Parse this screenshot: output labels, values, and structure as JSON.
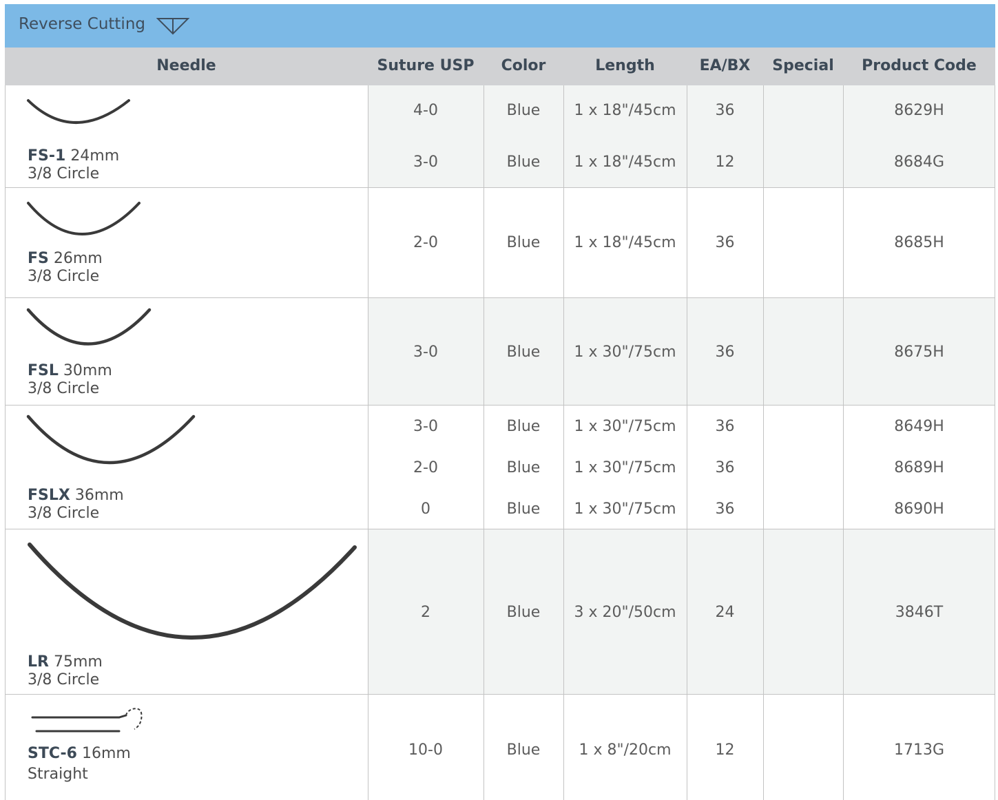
{
  "section": {
    "title": "Reverse Cutting",
    "icon": "reverse-cutting-triangle-icon",
    "color": "#7cb9e6"
  },
  "columns": {
    "needle": "Needle",
    "suture_usp": "Suture USP",
    "color": "Color",
    "length": "Length",
    "ea_bx": "EA/BX",
    "special": "Special",
    "product_code": "Product Code"
  },
  "groups": [
    {
      "needle_code": "FS-1",
      "needle_size": "24mm",
      "needle_shape": "3/8 Circle",
      "rows": [
        {
          "usp": "4-0",
          "color": "Blue",
          "length": "1 x 18\"/45cm",
          "ea_bx": "36",
          "special": "",
          "code": "8629H"
        },
        {
          "usp": "3-0",
          "color": "Blue",
          "length": "1 x 18\"/45cm",
          "ea_bx": "12",
          "special": "",
          "code": "8684G"
        }
      ]
    },
    {
      "needle_code": "FS",
      "needle_size": "26mm",
      "needle_shape": "3/8 Circle",
      "rows": [
        {
          "usp": "2-0",
          "color": "Blue",
          "length": "1 x 18\"/45cm",
          "ea_bx": "36",
          "special": "",
          "code": "8685H"
        }
      ]
    },
    {
      "needle_code": "FSL",
      "needle_size": "30mm",
      "needle_shape": "3/8 Circle",
      "rows": [
        {
          "usp": "3-0",
          "color": "Blue",
          "length": "1 x 30\"/75cm",
          "ea_bx": "36",
          "special": "",
          "code": "8675H"
        }
      ]
    },
    {
      "needle_code": "FSLX",
      "needle_size": "36mm",
      "needle_shape": "3/8 Circle",
      "rows": [
        {
          "usp": "3-0",
          "color": "Blue",
          "length": "1 x 30\"/75cm",
          "ea_bx": "36",
          "special": "",
          "code": "8649H"
        },
        {
          "usp": "2-0",
          "color": "Blue",
          "length": "1 x 30\"/75cm",
          "ea_bx": "36",
          "special": "",
          "code": "8689H"
        },
        {
          "usp": "0",
          "color": "Blue",
          "length": "1 x 30\"/75cm",
          "ea_bx": "36",
          "special": "",
          "code": "8690H"
        }
      ]
    },
    {
      "needle_code": "LR",
      "needle_size": "75mm",
      "needle_shape": "3/8 Circle",
      "rows": [
        {
          "usp": "2",
          "color": "Blue",
          "length": "3 x 20\"/50cm",
          "ea_bx": "24",
          "special": "",
          "code": "3846T"
        }
      ]
    },
    {
      "needle_code": "STC-6",
      "needle_size": "16mm",
      "needle_shape": "Straight",
      "rows": [
        {
          "usp": "10-0",
          "color": "Blue",
          "length": "1 x 8\"/20cm",
          "ea_bx": "12",
          "special": "",
          "code": "1713G"
        }
      ]
    }
  ]
}
